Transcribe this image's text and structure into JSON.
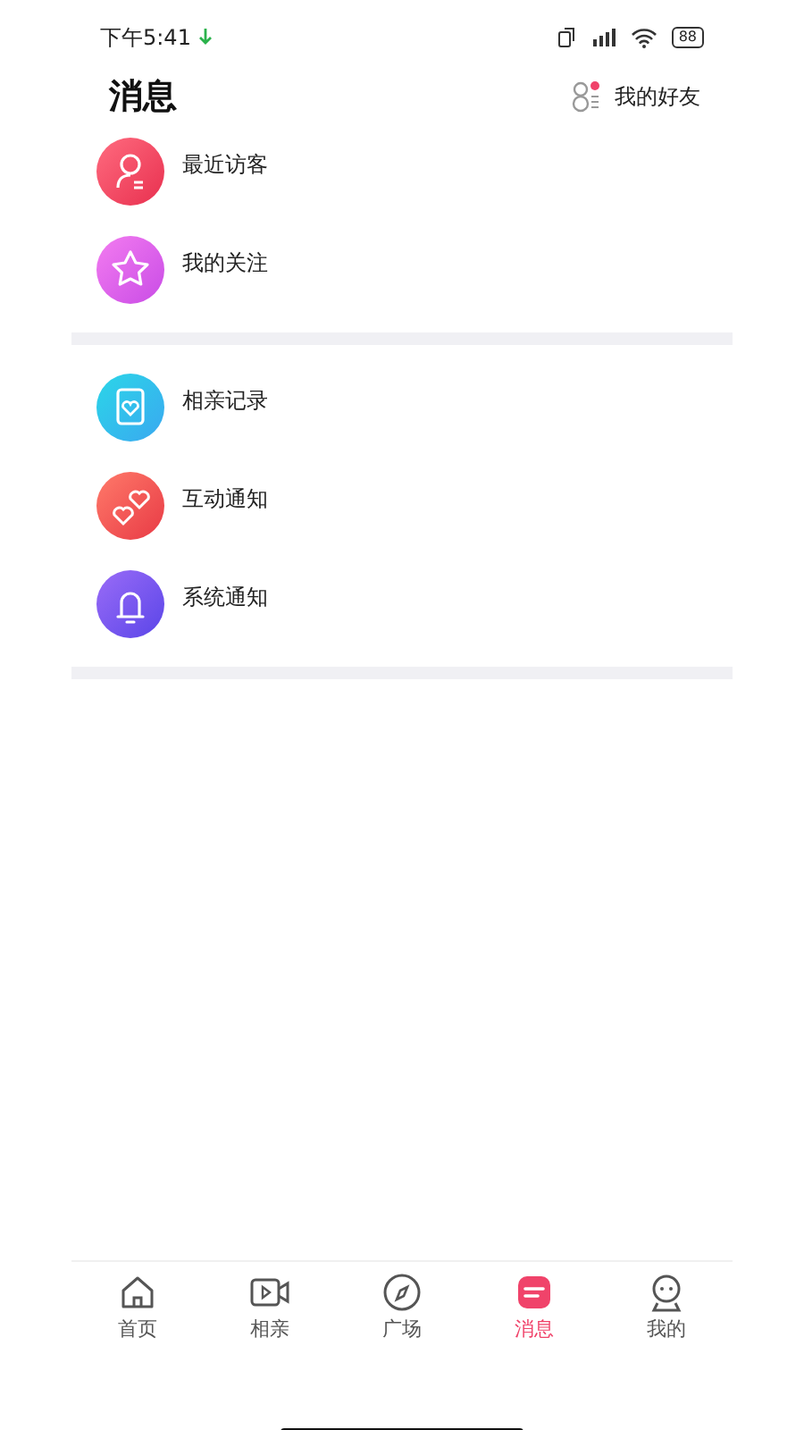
{
  "status_bar": {
    "time": "下午5:41",
    "battery": "88"
  },
  "header": {
    "title": "消息",
    "friends_label": "我的好友"
  },
  "sections": [
    {
      "items": [
        {
          "label": "最近访客"
        },
        {
          "label": "我的关注"
        }
      ]
    },
    {
      "items": [
        {
          "label": "相亲记录"
        },
        {
          "label": "互动通知"
        },
        {
          "label": "系统通知"
        }
      ]
    }
  ],
  "tabs": [
    {
      "label": "首页",
      "selected": false
    },
    {
      "label": "相亲",
      "selected": false
    },
    {
      "label": "广场",
      "selected": false
    },
    {
      "label": "消息",
      "selected": true
    },
    {
      "label": "我的",
      "selected": false
    }
  ]
}
